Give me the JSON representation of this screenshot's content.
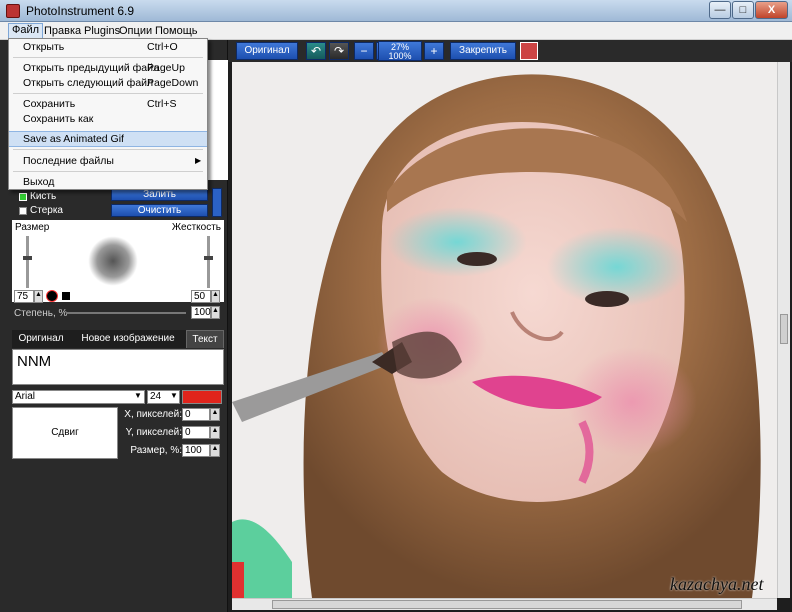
{
  "window": {
    "title": "PhotoInstrument 6.9",
    "min_glyph": "—",
    "max_glyph": "□",
    "close_glyph": "X"
  },
  "menu": {
    "items": [
      "Файл",
      "Правка",
      "Plugins",
      "Опции",
      "Помощь"
    ]
  },
  "file_menu": [
    {
      "label": "Открыть",
      "shortcut": "Ctrl+O"
    },
    {
      "label": "Открыть предыдущий файл",
      "shortcut": "PageUp"
    },
    {
      "label": "Открыть следующий файл",
      "shortcut": "PageDown"
    },
    {
      "label": "Сохранить",
      "shortcut": "Ctrl+S"
    },
    {
      "label": "Сохранить как",
      "shortcut": ""
    },
    {
      "label": "Save as Animated Gif",
      "shortcut": ""
    },
    {
      "label": "Последние файлы",
      "shortcut": "▶"
    },
    {
      "label": "Выход",
      "shortcut": ""
    }
  ],
  "toolbar": {
    "original_label": "Оригинал",
    "zoom_top": "27%",
    "zoom_bottom": "100%",
    "pin_label": "Закрепить",
    "undo_glyph": "↶",
    "redo_glyph": "↷",
    "zoom_in_glyph": "+",
    "zoom_out_glyph": "−"
  },
  "brush_panel": {
    "fill_label": "Залить",
    "clear_label": "Очистить",
    "brush_label": "Кисть",
    "eraser_label": "Стерка",
    "size_label": "Размер",
    "hardness_label": "Жесткость",
    "size_value": "75",
    "hardness_value": "50",
    "degree_label": "Степень, %",
    "degree_value": "100"
  },
  "tabs": [
    "Оригинал",
    "Новое изображение",
    "Текст"
  ],
  "text_panel": {
    "text_value": "NNM",
    "font": "Arial",
    "font_size": "24",
    "text_color": "#e0241c",
    "shift_label": "Сдвиг",
    "x_label": "X, пикселей:",
    "x_value": "0",
    "y_label": "Y, пикселей:",
    "y_value": "0",
    "scale_label": "Размер, %:",
    "scale_value": "100"
  },
  "watermark": "kazachya.net",
  "colors": {
    "accent": "#2b62c6",
    "panel": "#2a2a2a"
  }
}
